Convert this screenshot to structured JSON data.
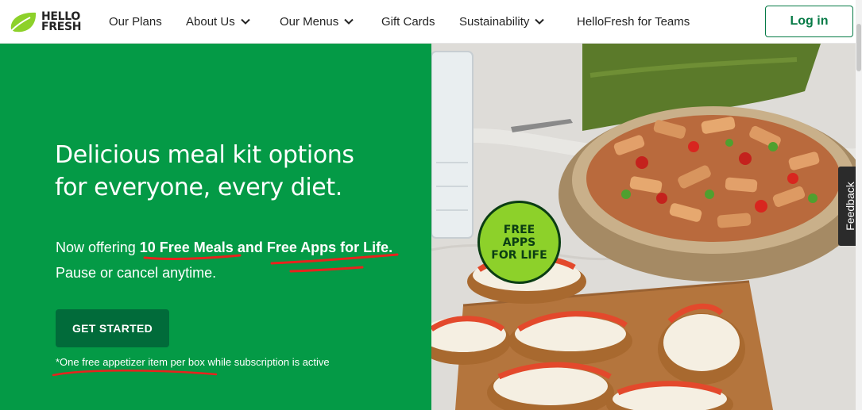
{
  "brand": {
    "line1": "HELLO",
    "line2": "FRESH"
  },
  "nav": {
    "items": [
      {
        "label": "Our Plans",
        "dropdown": false
      },
      {
        "label": "About Us",
        "dropdown": true
      },
      {
        "label": "Our Menus",
        "dropdown": true
      },
      {
        "label": "Gift Cards",
        "dropdown": false
      },
      {
        "label": "Sustainability",
        "dropdown": true
      },
      {
        "label": "HelloFresh for Teams",
        "dropdown": false
      }
    ],
    "login_label": "Log in"
  },
  "hero": {
    "headline_line1": "Delicious meal kit options",
    "headline_line2": "for everyone, every diet.",
    "offer_prefix": "Now offering ",
    "offer_bold1": "10 Free Meals",
    "offer_and": " and ",
    "offer_bold2": "Free Apps for Life.",
    "offer_line2": "Pause or cancel anytime.",
    "cta_label": "GET STARTED",
    "disclaimer": "*One free appetizer item per box while subscription is active"
  },
  "badge": {
    "line1": "FREE",
    "line2": "APPS",
    "line3": "FOR LIFE"
  },
  "feedback": {
    "label": "Feedback"
  },
  "colors": {
    "brand_green": "#049a46",
    "button_dark_green": "#016b3a",
    "logo_lime": "#8dd12a",
    "annotation_red": "#e8231d"
  },
  "icons": [
    "hellofresh-leaf-icon",
    "chevron-down-icon"
  ]
}
